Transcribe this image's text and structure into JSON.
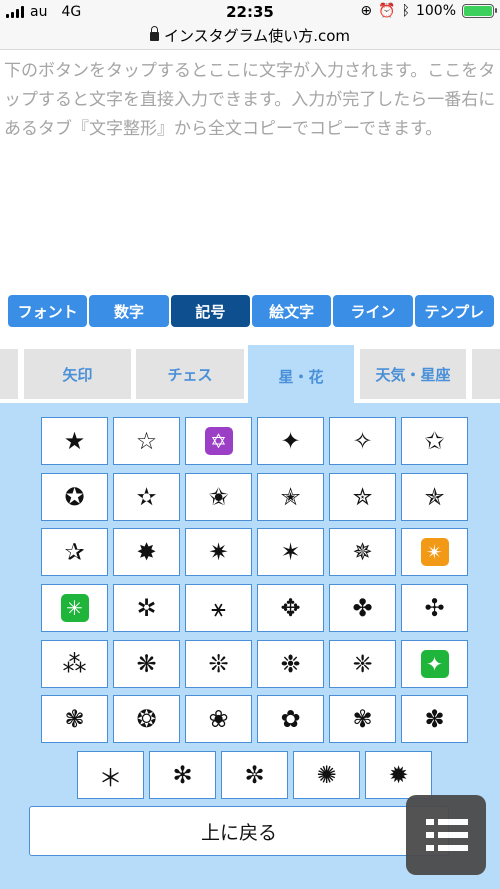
{
  "status": {
    "carrier": "au",
    "network": "4G",
    "time": "22:35",
    "battery": "100%",
    "battery_level": 1.0,
    "battery_color": "#3bd15c"
  },
  "url": {
    "domain": "インスタグラム使い方.com"
  },
  "textarea": {
    "placeholder": "下のボタンをタップするとここに文字が入力されます。ここをタップすると文字を直接入力できます。入力が完了したら一番右にあるタブ『文字整形』から全文コピーでコピーできます。"
  },
  "category_tabs": [
    {
      "label": "フォント",
      "active": false
    },
    {
      "label": "数字",
      "active": false
    },
    {
      "label": "記号",
      "active": true
    },
    {
      "label": "絵文字",
      "active": false
    },
    {
      "label": "ライン",
      "active": false
    },
    {
      "label": "テンプレ",
      "active": false
    }
  ],
  "sub_tabs": [
    {
      "label": "",
      "active": false
    },
    {
      "label": "矢印",
      "active": false
    },
    {
      "label": "チェス",
      "active": false
    },
    {
      "label": "星・花",
      "active": true
    },
    {
      "label": "天気・星座",
      "active": false
    },
    {
      "label": "",
      "active": false
    }
  ],
  "symbols": [
    [
      "★",
      "☆",
      "emoji:purple:✡",
      "✦",
      "✧",
      "✩"
    ],
    [
      "✪",
      "✫",
      "✬",
      "✭",
      "✮",
      "✯"
    ],
    [
      "✰",
      "✸",
      "✷",
      "✶",
      "✵",
      "emoji:orange:✴"
    ],
    [
      "emoji:green:✳",
      "✲",
      "⚹",
      "✥",
      "✤",
      "✣"
    ],
    [
      "⁂",
      "❋",
      "❊",
      "❉",
      "❈",
      "emoji:green:✦"
    ],
    [
      "❃",
      "❂",
      "❀",
      "✿",
      "✾",
      "✽"
    ],
    [
      "＊",
      "✻",
      "✼",
      "✺",
      "✹"
    ]
  ],
  "back_button": {
    "label": "上に戻る"
  },
  "colors": {
    "accent": "#3a8ee6",
    "active_tab": "#0d4f8f",
    "panel_bg": "#b6dcf9",
    "cell_border": "#4a90d9"
  },
  "icons": {
    "menu": "list-menu-icon",
    "lock": "lock-icon"
  }
}
